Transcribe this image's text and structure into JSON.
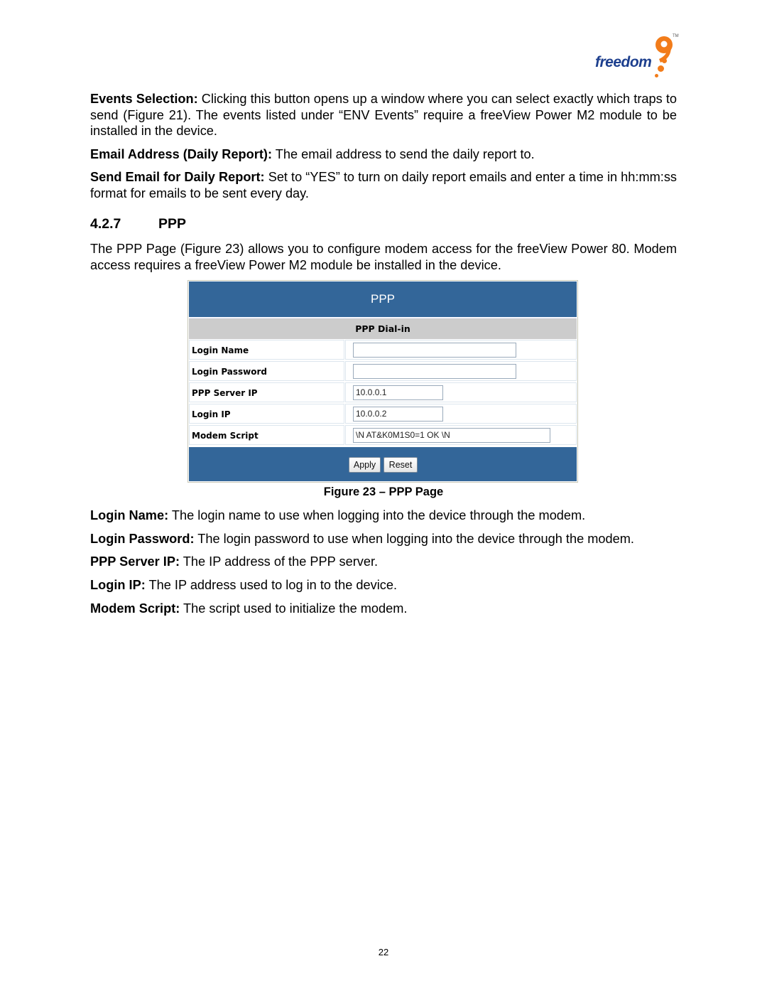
{
  "logo": {
    "text": "freedom",
    "numeral": "9",
    "tm": "TM",
    "brand_color": "#f27c1a",
    "text_color": "#1d3f8e"
  },
  "intro_paragraphs": [
    {
      "term": "Events Selection:",
      "text": " Clicking this button opens up a window where you can select exactly which traps to send (Figure 21). The events listed under “ENV Events” require a freeView Power M2 module to be installed in the device."
    },
    {
      "term": "Email Address (Daily Report):",
      "text": " The email address to send the daily report to."
    },
    {
      "term": "Send Email for Daily Report:",
      "text": " Set to “YES” to turn on daily report emails and enter a time in hh:mm:ss format for emails to be sent every day."
    }
  ],
  "section": {
    "number": "4.2.7",
    "title": "PPP"
  },
  "section_intro": "The PPP Page (Figure 23) allows you to configure modem access for the freeView Power 80. Modem access requires a freeView Power M2 module be installed in the device.",
  "figure": {
    "title": "PPP",
    "subtitle": "PPP Dial-in",
    "header_color": "#336699",
    "fields": [
      {
        "label": "Login Name",
        "value": ""
      },
      {
        "label": "Login Password",
        "value": ""
      },
      {
        "label": "PPP Server IP",
        "value": "10.0.0.1"
      },
      {
        "label": "Login IP",
        "value": "10.0.0.2"
      },
      {
        "label": "Modem Script",
        "value": "\\N AT&K0M1S0=1 OK \\N"
      }
    ],
    "buttons": {
      "apply": "Apply",
      "reset": "Reset"
    },
    "caption": "Figure 23 – PPP Page"
  },
  "definitions": [
    {
      "term": "Login Name:",
      "text": " The login name to use when logging into the device through the modem."
    },
    {
      "term": "Login Password:",
      "text": " The login password to use when logging into the device through the modem."
    },
    {
      "term": "PPP Server IP:",
      "text": " The IP address of the PPP server."
    },
    {
      "term": "Login IP:",
      "text": " The IP address used to log in to the device."
    },
    {
      "term": "Modem Script:",
      "text": " The script used to initialize the modem."
    }
  ],
  "page_number": "22"
}
